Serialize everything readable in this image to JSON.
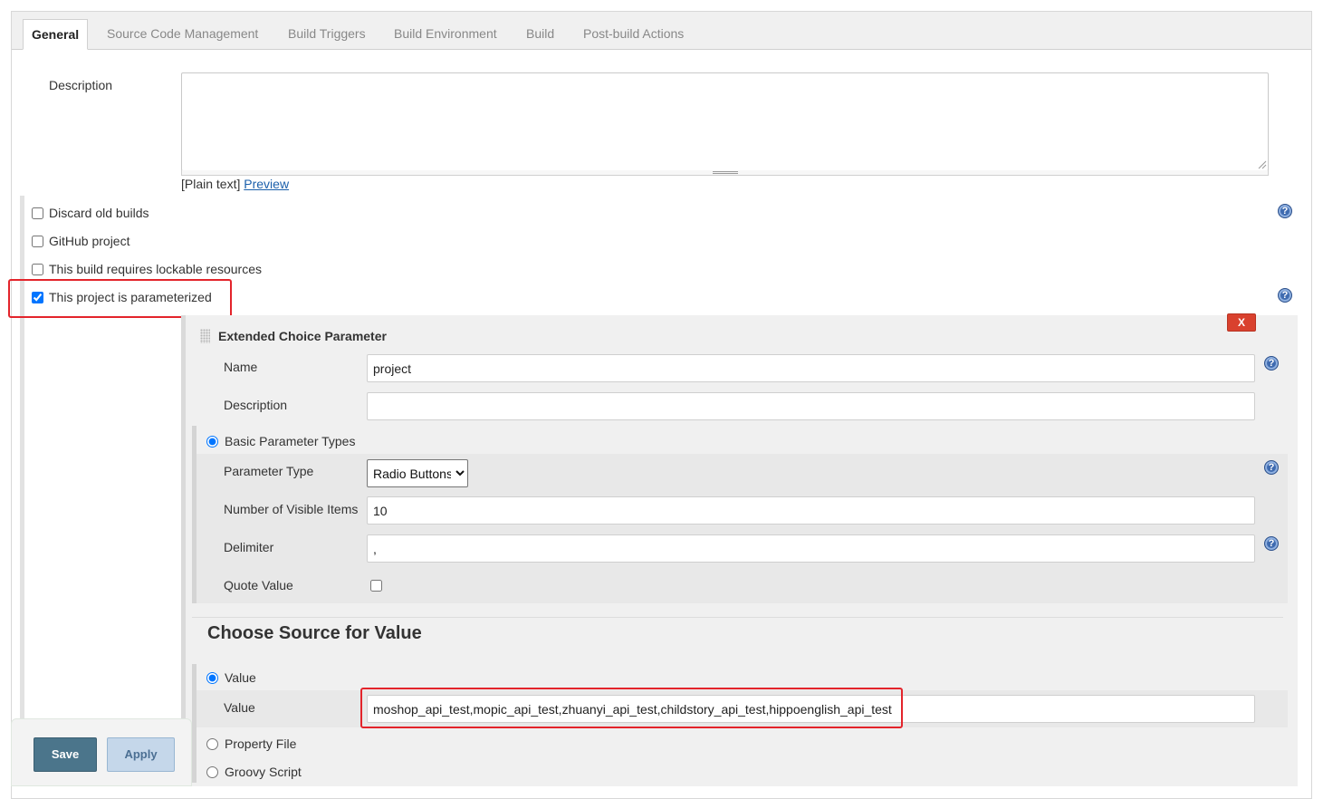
{
  "tabs": [
    {
      "label": "General",
      "active": true
    },
    {
      "label": "Source Code Management"
    },
    {
      "label": "Build Triggers"
    },
    {
      "label": "Build Environment"
    },
    {
      "label": "Build"
    },
    {
      "label": "Post-build Actions"
    }
  ],
  "description": {
    "label": "Description",
    "value": "",
    "format_text": "[Plain text]",
    "preview_link": "Preview"
  },
  "options": [
    {
      "label": "Discard old builds",
      "checked": false
    },
    {
      "label": "GitHub project",
      "checked": false
    },
    {
      "label": "This build requires lockable resources",
      "checked": false
    },
    {
      "label": "This project is parameterized",
      "checked": true
    }
  ],
  "parameter": {
    "title": "Extended Choice Parameter",
    "delete_label": "X",
    "name_label": "Name",
    "name_value": "project",
    "description_label": "Description",
    "description_value": "",
    "basic_types_label": "Basic Parameter Types",
    "parameter_type_label": "Parameter Type",
    "parameter_type_value": "Radio Buttons",
    "visible_items_label": "Number of Visible Items",
    "visible_items_value": "10",
    "delimiter_label": "Delimiter",
    "delimiter_value": ",",
    "quote_value_label": "Quote Value",
    "quote_value_checked": false
  },
  "source": {
    "title": "Choose Source for Value",
    "value_radio_label": "Value",
    "value_label": "Value",
    "value_text": "moshop_api_test,mopic_api_test,zhuanyi_api_test,childstory_api_test,hippoenglish_api_test",
    "property_file_label": "Property File",
    "groovy_script_label": "Groovy Script"
  },
  "buttons": {
    "save": "Save",
    "apply": "Apply"
  },
  "icons": {
    "help": "question-mark-help-icon",
    "drag": "drag-handle-icon"
  },
  "colors": {
    "highlight": "#e3242b",
    "delete_button": "#d9412e",
    "save_button": "#4b758b",
    "help_icon": "#3f6bb0"
  }
}
